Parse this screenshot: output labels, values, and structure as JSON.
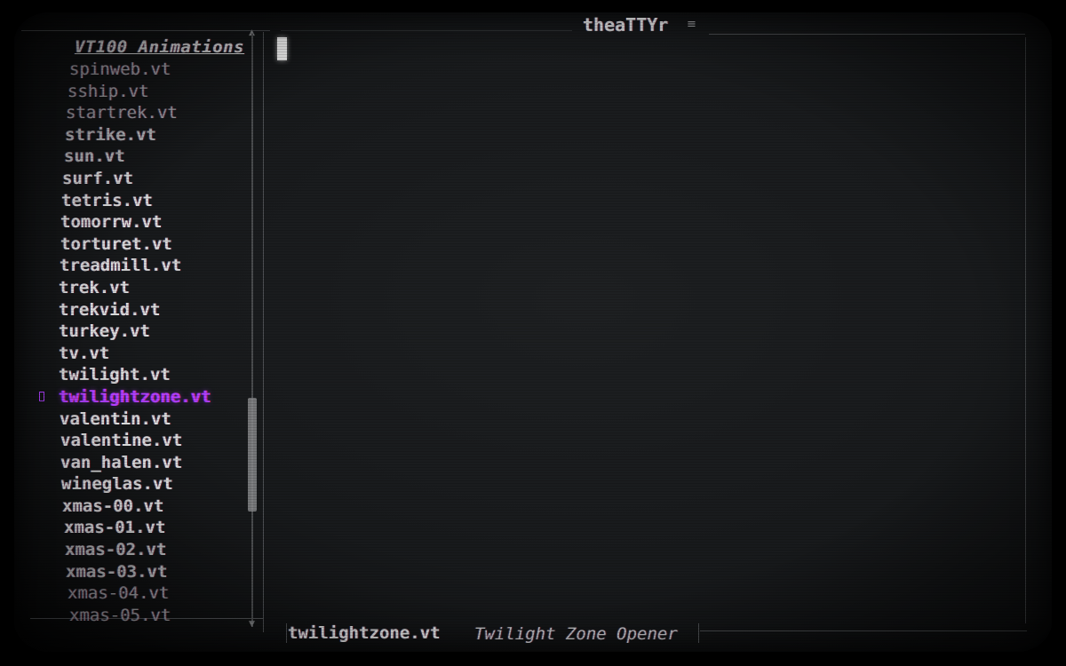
{
  "window": {
    "title": "theaTTYr",
    "title_icon": "menu-icon"
  },
  "sidebar": {
    "title": "VT100 Animations",
    "items": [
      {
        "label": "spinweb.vt"
      },
      {
        "label": "sship.vt"
      },
      {
        "label": "startrek.vt"
      },
      {
        "label": "strike.vt"
      },
      {
        "label": "sun.vt"
      },
      {
        "label": "surf.vt"
      },
      {
        "label": "tetris.vt"
      },
      {
        "label": "tomorrw.vt"
      },
      {
        "label": "torturet.vt"
      },
      {
        "label": "treadmill.vt"
      },
      {
        "label": "trek.vt"
      },
      {
        "label": "trekvid.vt"
      },
      {
        "label": "turkey.vt"
      },
      {
        "label": "tv.vt"
      },
      {
        "label": "twilight.vt"
      },
      {
        "label": "twilightzone.vt",
        "selected": true
      },
      {
        "label": "valentin.vt"
      },
      {
        "label": "valentine.vt"
      },
      {
        "label": "van_halen.vt"
      },
      {
        "label": "wineglas.vt"
      },
      {
        "label": "xmas-00.vt"
      },
      {
        "label": "xmas-01.vt"
      },
      {
        "label": "xmas-02.vt"
      },
      {
        "label": "xmas-03.vt"
      },
      {
        "label": "xmas-04.vt"
      },
      {
        "label": "xmas-05.vt"
      }
    ],
    "selected_marker": "▯"
  },
  "status": {
    "filename": "twilightzone.vt",
    "description": "Twilight Zone Opener"
  },
  "colors": {
    "background": "#1a1c1e",
    "text": "#d8d9d9",
    "selected": "#b040ff",
    "frame": "#5b5e61"
  }
}
